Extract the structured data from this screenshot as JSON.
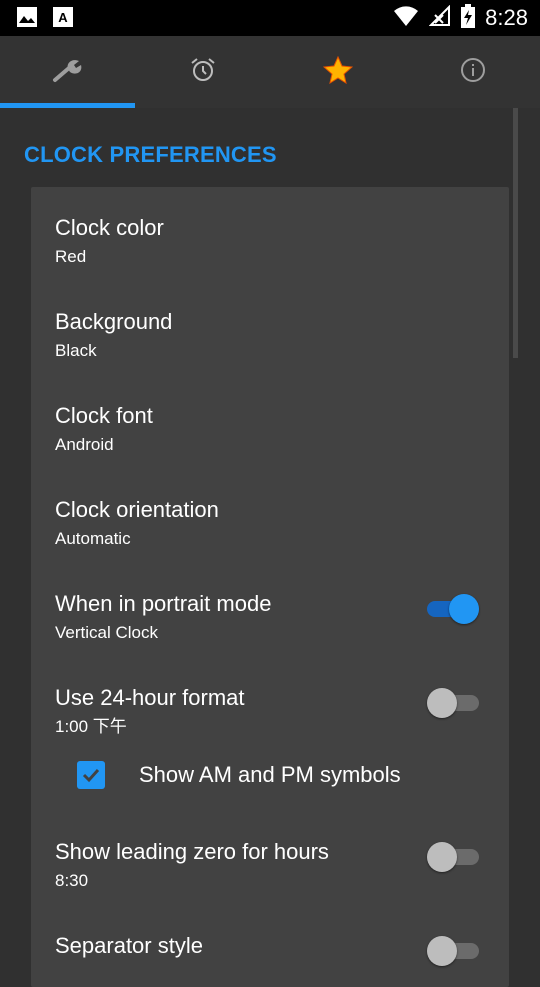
{
  "status_bar": {
    "time": "8:28",
    "left_icons": [
      "image-icon",
      "a-square-icon"
    ],
    "right_icons": [
      "wifi-icon",
      "signal-icon",
      "battery-icon"
    ]
  },
  "tabs": [
    {
      "icon": "wrench-icon",
      "active": true
    },
    {
      "icon": "alarm-clock-icon",
      "active": false
    },
    {
      "icon": "star-icon",
      "active": false
    },
    {
      "icon": "info-icon",
      "active": false
    }
  ],
  "section": {
    "title": "CLOCK PREFERENCES"
  },
  "prefs": [
    {
      "title": "Clock color",
      "summary": "Red"
    },
    {
      "title": "Background",
      "summary": "Black"
    },
    {
      "title": "Clock font",
      "summary": "Android"
    },
    {
      "title": "Clock orientation",
      "summary": "Automatic"
    },
    {
      "title": "When in portrait mode",
      "summary": "Vertical Clock",
      "switch": "on"
    },
    {
      "title": "Use 24-hour format",
      "summary": "1:00 下午",
      "switch": "off"
    },
    {
      "title": "Show leading zero for hours",
      "summary": "8:30",
      "switch": "off"
    },
    {
      "title": "Separator style",
      "switch": "off"
    }
  ],
  "checkbox": {
    "label": "Show AM and PM symbols",
    "checked": true
  },
  "colors": {
    "accent": "#2196F3",
    "background": "#303030",
    "card": "#424242"
  }
}
